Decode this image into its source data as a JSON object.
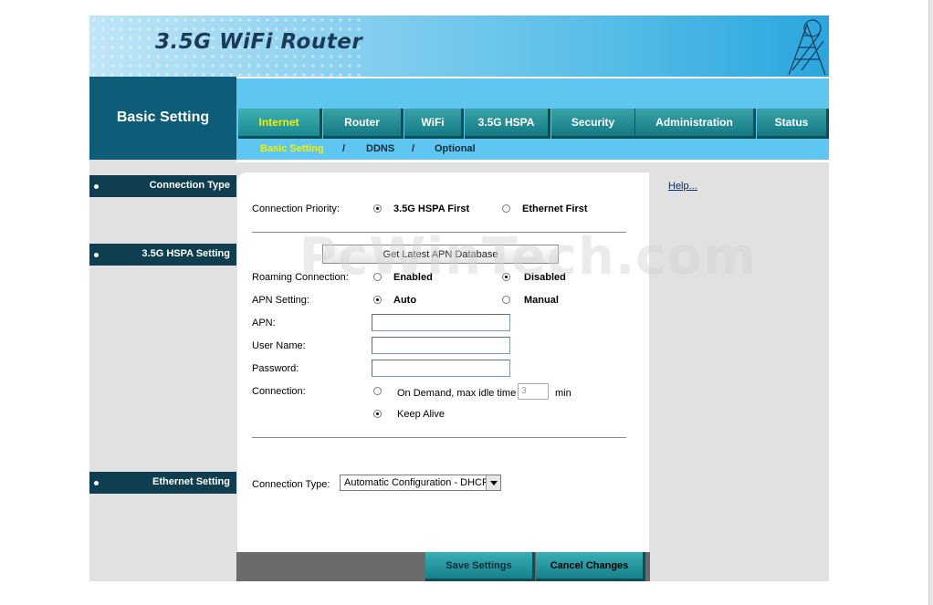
{
  "header": {
    "title": "3.5G WiFi Router"
  },
  "section_title": "Basic Setting",
  "tabs": [
    {
      "label": "Internet",
      "active": true
    },
    {
      "label": "Router",
      "active": false
    },
    {
      "label": "WiFi",
      "active": false
    },
    {
      "label": "3.5G HSPA",
      "active": false
    },
    {
      "label": "Security",
      "active": false
    },
    {
      "label": "Administration",
      "active": false
    },
    {
      "label": "Status",
      "active": false
    }
  ],
  "subnav": {
    "items": [
      {
        "label": "Basic Setting",
        "active": true
      },
      {
        "label": "DDNS",
        "active": false
      },
      {
        "label": "Optional",
        "active": false
      }
    ],
    "separator": "/"
  },
  "sidebar": {
    "headings": [
      "Connection Type",
      "3.5G HSPA Setting",
      "Ethernet Setting"
    ]
  },
  "form": {
    "connection_priority": {
      "label": "Connection Priority:",
      "options": [
        "3.5G HSPA First",
        "Ethernet First"
      ],
      "selected": "3.5G HSPA First"
    },
    "apn_database_button": "Get Latest APN Database",
    "roaming": {
      "label": "Roaming Connection:",
      "options": [
        "Enabled",
        "Disabled"
      ],
      "selected": "Disabled"
    },
    "apn_setting": {
      "label": "APN Setting:",
      "options": [
        "Auto",
        "Manual"
      ],
      "selected": "Auto"
    },
    "apn": {
      "label": "APN:",
      "value": ""
    },
    "user_name": {
      "label": "User Name:",
      "value": ""
    },
    "password": {
      "label": "Password:",
      "value": ""
    },
    "connection": {
      "label": "Connection:",
      "on_demand_label": "On Demand, max idle time",
      "idle_value": "3",
      "idle_unit": "min",
      "keep_alive_label": "Keep Alive",
      "selected": "Keep Alive"
    },
    "connection_type": {
      "label": "Connection Type:",
      "selected": "Automatic Configuration - DHCP"
    }
  },
  "help": {
    "link_label": "Help..."
  },
  "footer": {
    "save_label": "Save Settings",
    "cancel_label": "Cancel Changes"
  },
  "watermark": "PcWinTech.com",
  "colors": {
    "accent_teal": "#137a84",
    "nav_blue": "#5fc6f1",
    "section_dark": "#0e5d78",
    "active_tab_text": "#f4f000"
  }
}
